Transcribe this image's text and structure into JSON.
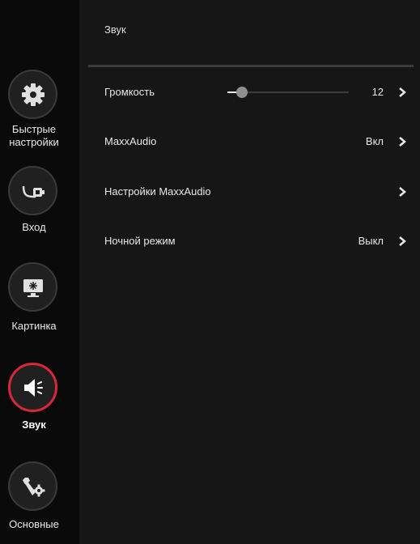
{
  "sidebar": {
    "items": [
      {
        "label_line1": "Быстрые",
        "label_line2": "настройки",
        "icon": "gear-icon",
        "active": false
      },
      {
        "label": "Вход",
        "icon": "input-cable-icon",
        "active": false
      },
      {
        "label": "Картинка",
        "icon": "picture-icon",
        "active": false
      },
      {
        "label": "Звук",
        "icon": "speaker-icon",
        "active": true
      },
      {
        "label": "Основные",
        "icon": "tools-gear-icon",
        "active": false
      }
    ]
  },
  "main": {
    "title": "Звук",
    "rows": [
      {
        "label": "Громкость",
        "value": "12",
        "slider_level": 0.12
      },
      {
        "label": "MaxxAudio",
        "value": "Вкл"
      },
      {
        "label": "Настройки MaxxAudio",
        "value": ""
      },
      {
        "label": "Ночной режим",
        "value": "Выкл"
      }
    ]
  },
  "colors": {
    "active_ring": "#d8273b",
    "background": "#161616",
    "sidebar": "#0a0a0a"
  }
}
